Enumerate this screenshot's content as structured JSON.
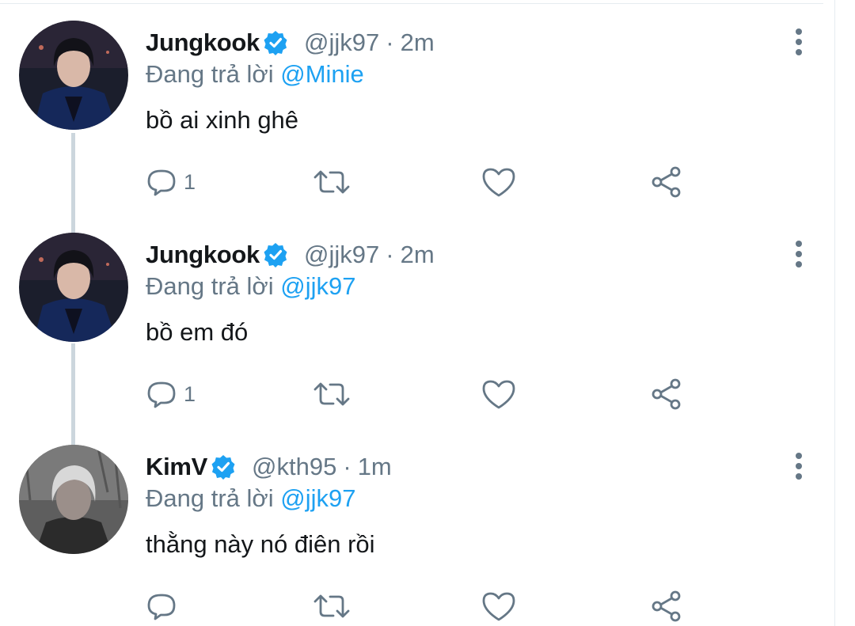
{
  "colors": {
    "accent": "#1da1f2",
    "secondary_text": "#657786",
    "primary_text": "#14171a",
    "thread_line": "#ccd6dd",
    "verified_badge": "#1da1f2"
  },
  "tweets": [
    {
      "display_name": "Jungkook",
      "verified": true,
      "handle": "@jjk97",
      "separator": "·",
      "time": "2m",
      "replying_prefix": "Đang trả lời",
      "replying_to": "@Minie",
      "text": "bồ ai xinh ghê",
      "reply_count": "1",
      "icons": [
        "more-vertical-icon",
        "reply-icon",
        "retweet-icon",
        "like-icon",
        "share-icon"
      ]
    },
    {
      "display_name": "Jungkook",
      "verified": true,
      "handle": "@jjk97",
      "separator": "·",
      "time": "2m",
      "replying_prefix": "Đang trả lời",
      "replying_to": "@jjk97",
      "text": "bồ em đó",
      "reply_count": "1",
      "icons": [
        "more-vertical-icon",
        "reply-icon",
        "retweet-icon",
        "like-icon",
        "share-icon"
      ]
    },
    {
      "display_name": "KimV",
      "verified": true,
      "handle": "@kth95",
      "separator": "·",
      "time": "1m",
      "replying_prefix": "Đang trả lời",
      "replying_to": "@jjk97",
      "text": "thằng này nó điên rồi",
      "reply_count": "",
      "icons": [
        "more-vertical-icon",
        "reply-icon",
        "retweet-icon",
        "like-icon",
        "share-icon"
      ]
    }
  ]
}
